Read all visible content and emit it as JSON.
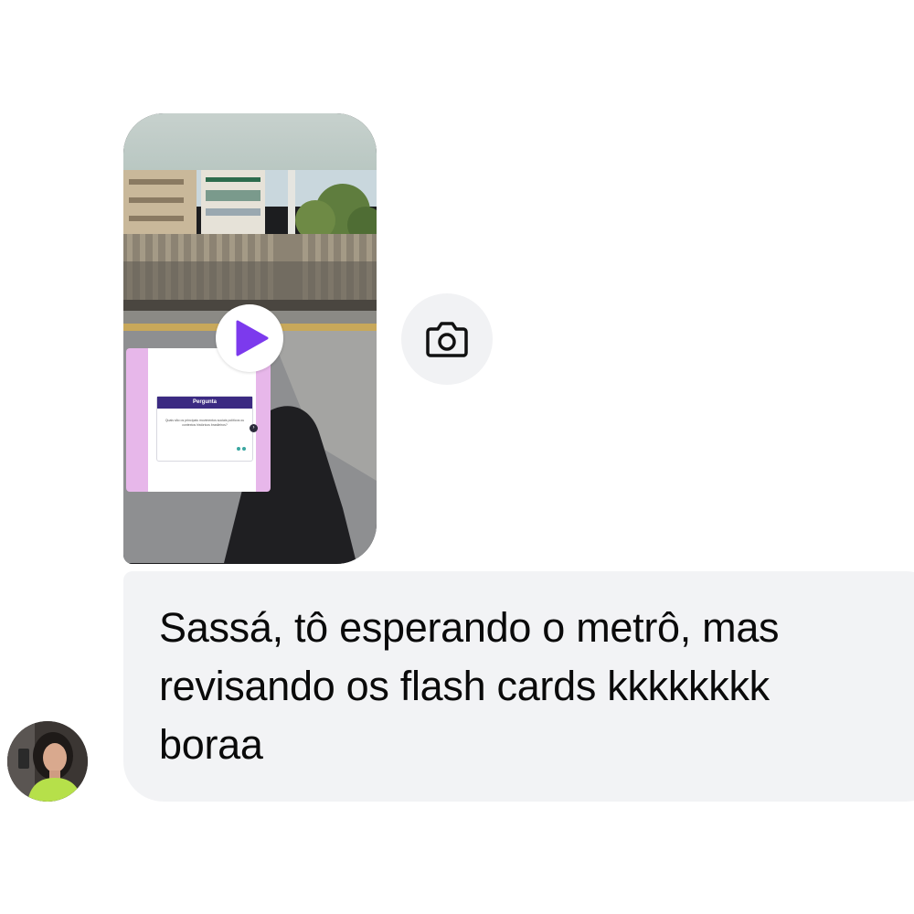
{
  "conversation": {
    "story_reply": {
      "media_type": "video",
      "play_icon": "play-icon",
      "accent_color": "#7c3aed",
      "flashcard": {
        "header": "Pergunta",
        "question": "Quais são os principais movimentos sociais políticos ou contextos históricos brasileiros?"
      }
    },
    "camera_action": {
      "icon": "camera-icon"
    },
    "message": {
      "lines": [
        "Sassá, tô esperando o metrô, mas",
        "revisando os flash cards kkkkkkkk",
        "boraa"
      ],
      "bubble_color": "#f2f3f5"
    },
    "sender": {
      "avatar": "avatar-photo"
    }
  }
}
